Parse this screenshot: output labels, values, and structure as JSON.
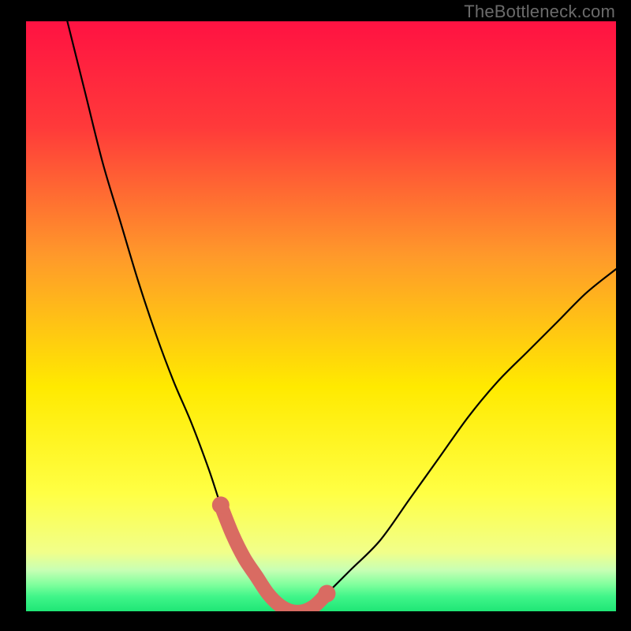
{
  "watermark": "TheBottleneck.com",
  "colors": {
    "frame": "#000000",
    "gradient_top": "#ff1242",
    "gradient_mid_upper": "#ff6a2f",
    "gradient_mid": "#ffea00",
    "gradient_lower": "#f7ff6e",
    "gradient_band": "#7fff9d",
    "gradient_bottom": "#23e776",
    "curve": "#000000",
    "marker": "#d96b62"
  },
  "chart_data": {
    "type": "line",
    "title": "",
    "xlabel": "",
    "ylabel": "",
    "xlim": [
      0,
      100
    ],
    "ylim": [
      0,
      100
    ],
    "grid": false,
    "series": [
      {
        "name": "bottleneck-curve",
        "x": [
          7,
          10,
          13,
          16,
          19,
          22,
          25,
          28,
          31,
          33,
          35,
          37,
          39,
          41,
          43,
          45,
          47,
          49,
          51,
          55,
          60,
          65,
          70,
          75,
          80,
          85,
          90,
          95,
          100
        ],
        "y": [
          100,
          88,
          76,
          66,
          56,
          47,
          39,
          32,
          24,
          18,
          13,
          9,
          6,
          3,
          1,
          0,
          0,
          1,
          3,
          7,
          12,
          19,
          26,
          33,
          39,
          44,
          49,
          54,
          58
        ]
      }
    ],
    "markers": {
      "name": "highlight-band",
      "x": [
        33,
        35,
        37,
        39,
        41,
        43,
        45,
        47,
        49,
        51
      ],
      "y": [
        18,
        13,
        9,
        6,
        3,
        1,
        0,
        0,
        1,
        3
      ]
    }
  }
}
